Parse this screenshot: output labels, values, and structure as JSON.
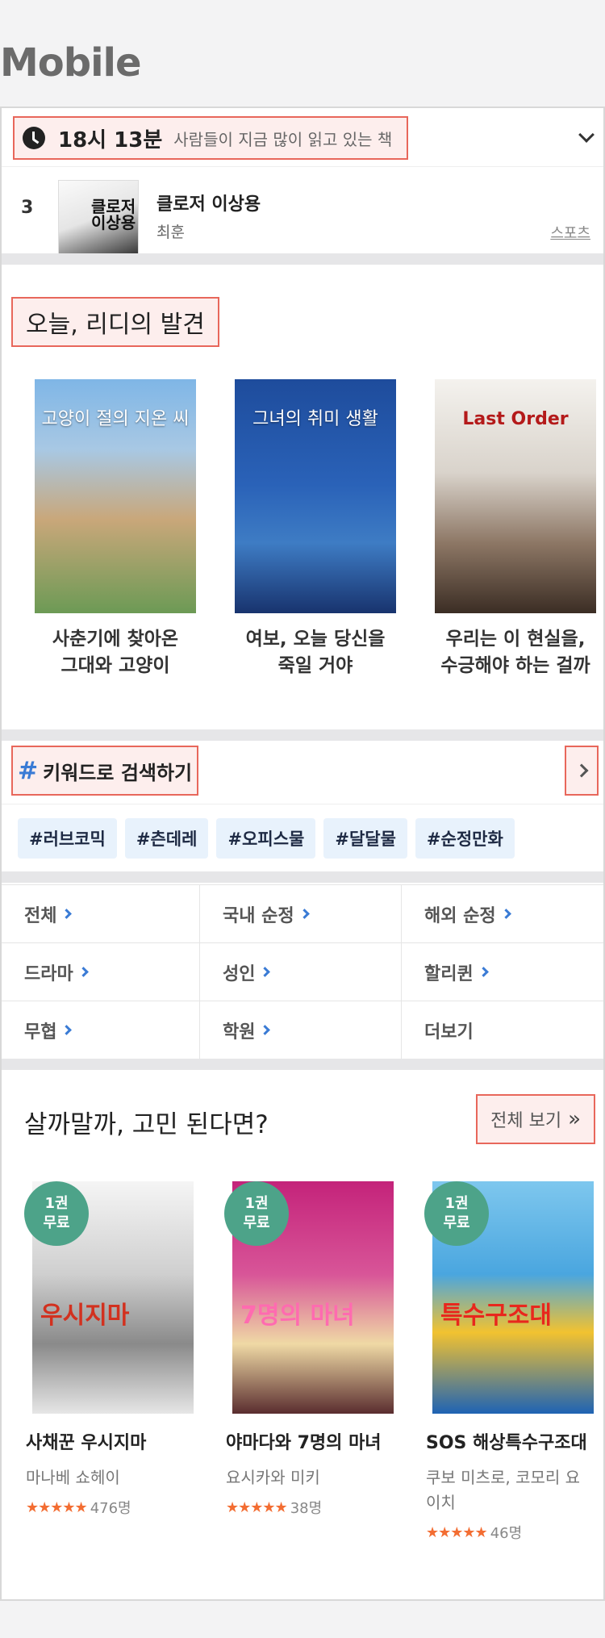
{
  "page": {
    "title": "Mobile"
  },
  "realtime": {
    "time": "18시 13분",
    "caption": "사람들이 지금 많이 읽고 있는 책",
    "item": {
      "rank": "3",
      "title": "클로저 이상용",
      "author": "최훈",
      "genre": "스포츠",
      "cover_text": "클로저 이상용"
    }
  },
  "discovery": {
    "title": "오늘, 리디의 발견",
    "books": [
      {
        "label": "사춘기에 찾아온\n그대와 고양이",
        "cover_text": "고양이 절의 지온 씨"
      },
      {
        "label": "여보, 오늘 당신을\n죽일 거야",
        "cover_text": "그녀의 취미 생활"
      },
      {
        "label": "우리는 이 현실을,\n수긍해야 하는 걸까",
        "cover_text": "Last Order"
      }
    ]
  },
  "keywords": {
    "title": "키워드로 검색하기",
    "chips": [
      "#러브코믹",
      "#츤데레",
      "#오피스물",
      "#달달물",
      "#순정만화"
    ]
  },
  "categories": [
    "전체",
    "국내 순정",
    "해외 순정",
    "드라마",
    "성인",
    "할리퀸",
    "무협",
    "학원",
    "더보기"
  ],
  "recommend": {
    "title": "살까말까, 고민 된다면?",
    "view_all": "전체 보기",
    "view_all_icon": "»",
    "badge_line1": "1권",
    "badge_line2": "무료",
    "books": [
      {
        "title": "사채꾼 우시지마",
        "author": "마나베 쇼헤이",
        "stars": "★★★★★",
        "rating_count": "476명",
        "cover_text": "우시지마"
      },
      {
        "title": "야마다와 7명의 마녀",
        "author": "요시카와 미키",
        "stars": "★★★★★",
        "rating_count": "38명",
        "cover_text": "7명의 마녀"
      },
      {
        "title": "SOS 해상특수구조대",
        "author": "쿠보 미츠로, 코모리 요이치",
        "stars": "★★★★★",
        "rating_count": "46명",
        "cover_text": "특수구조대"
      }
    ]
  },
  "colors": {
    "accent": "#3a7bd5",
    "badge": "#4da389",
    "star": "#f36d32",
    "highlight_border": "#e8675b"
  }
}
